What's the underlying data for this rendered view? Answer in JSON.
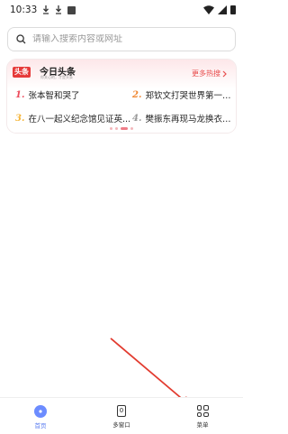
{
  "status": {
    "time": "10:33",
    "icons": [
      "download-icon",
      "download-icon",
      "notification-icon",
      "wifi-icon",
      "signal-icon",
      "battery-icon"
    ]
  },
  "search": {
    "placeholder": "请输入搜索内容或网址",
    "value": ""
  },
  "hot_card": {
    "badge": "头条",
    "brand": "今日头条",
    "brand_sub": "你关心的，才是头条",
    "more_label": "更多热搜",
    "items": [
      {
        "rank": "1.",
        "title": "张本智和哭了"
      },
      {
        "rank": "2.",
        "title": "郑钦文打哭世界第一斯瓦..."
      },
      {
        "rank": "3.",
        "title": "在八一起义纪念馆见证英..."
      },
      {
        "rank": "4.",
        "title": "樊振东再现马龙换衣翻盘"
      }
    ],
    "pager_dots": 4,
    "active_dot": 2
  },
  "tabbar": {
    "tabs": [
      {
        "label": "首页",
        "icon": "home-icon",
        "active": true
      },
      {
        "label": "多窗口",
        "icon": "windows-icon",
        "count": "0",
        "active": false
      },
      {
        "label": "菜单",
        "icon": "menu-grid-icon",
        "active": false
      }
    ]
  },
  "colors": {
    "accent": "#6c8cff",
    "hot_red": "#e84d4d",
    "annotation_arrow": "#e23b2f"
  }
}
